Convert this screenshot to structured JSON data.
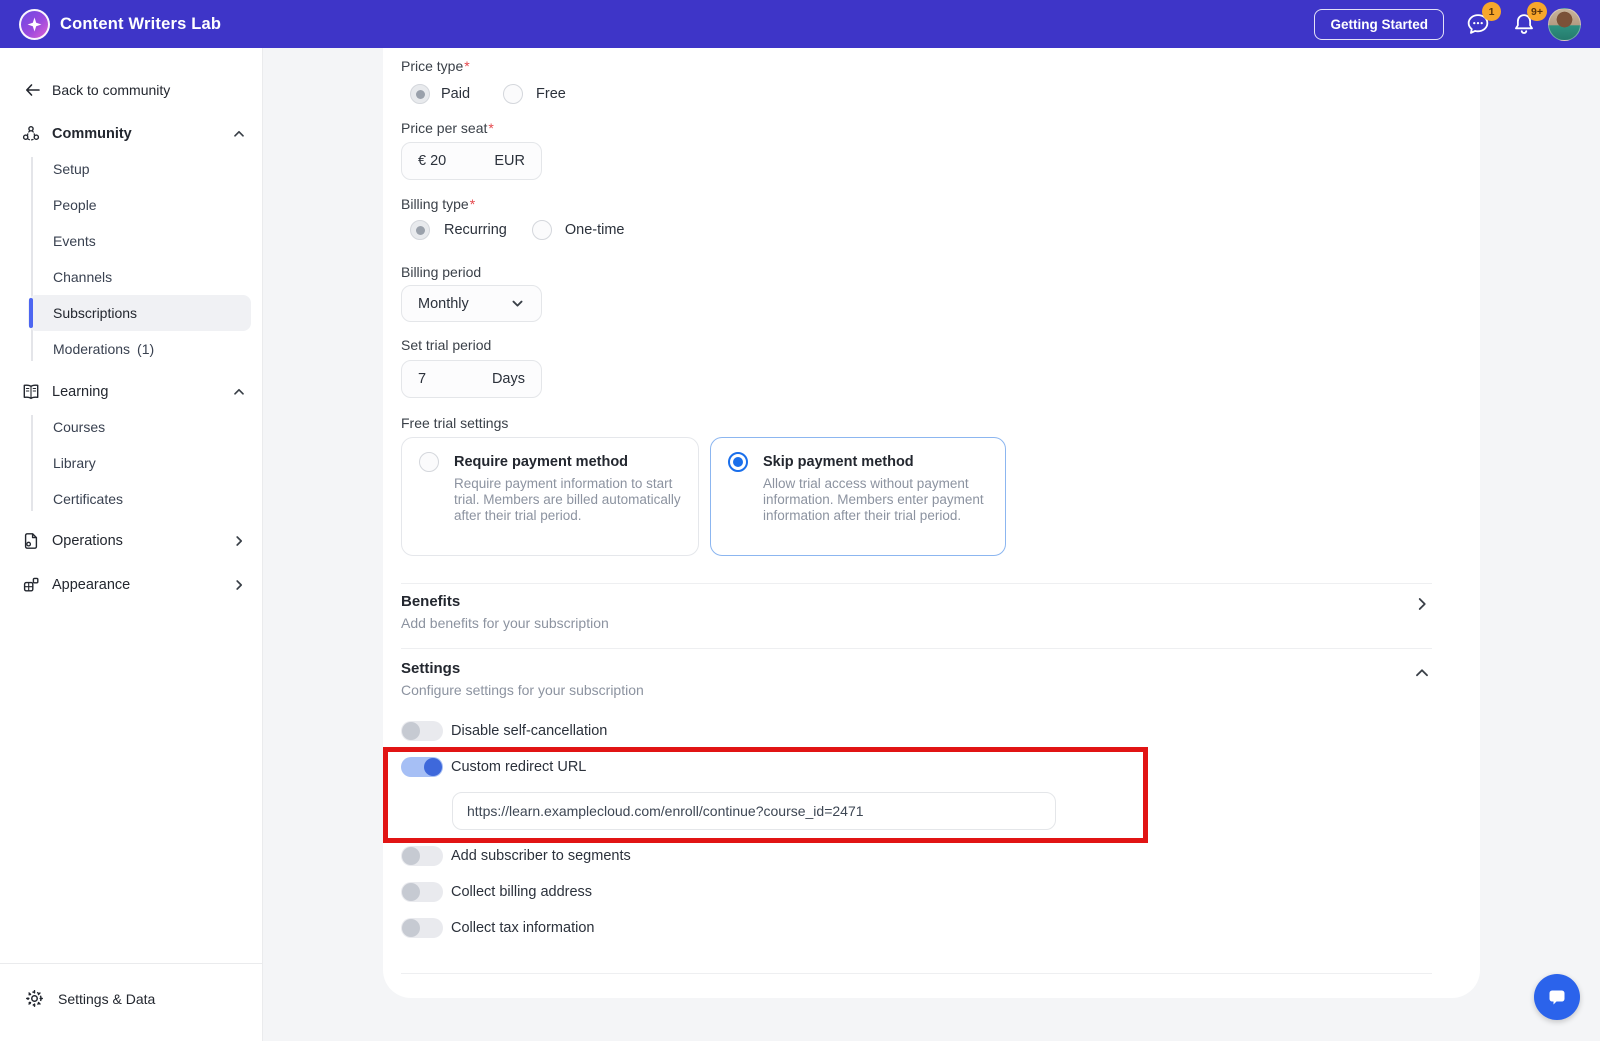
{
  "header": {
    "app_name": "Content Writers Lab",
    "getting_started": "Getting Started",
    "chat_badge": "1",
    "bell_badge": "9+"
  },
  "sidebar": {
    "back": "Back to community",
    "community": {
      "label": "Community",
      "items": {
        "setup": "Setup",
        "people": "People",
        "events": "Events",
        "channels": "Channels",
        "subscriptions": "Subscriptions",
        "moderations": "Moderations",
        "moderations_count": "(1)"
      }
    },
    "learning": {
      "label": "Learning",
      "items": {
        "courses": "Courses",
        "library": "Library",
        "certificates": "Certificates"
      }
    },
    "operations": "Operations",
    "appearance": "Appearance",
    "settings_data": "Settings & Data"
  },
  "form": {
    "required_mark": "*",
    "price_type": {
      "label": "Price type",
      "paid": "Paid",
      "free": "Free",
      "selected": "Paid"
    },
    "price_per_seat": {
      "label": "Price per seat",
      "value": "€ 20",
      "suffix": "EUR"
    },
    "billing_type": {
      "label": "Billing type",
      "recurring": "Recurring",
      "one_time": "One-time",
      "selected": "Recurring"
    },
    "billing_period": {
      "label": "Billing period",
      "value": "Monthly"
    },
    "trial_period": {
      "label": "Set trial period",
      "value": "7",
      "suffix": "Days"
    },
    "free_trial": {
      "label": "Free trial settings",
      "require": {
        "title": "Require payment method",
        "desc": "Require payment information to start trial. Members are billed automatically after their trial period.",
        "selected": false
      },
      "skip": {
        "title": "Skip payment method",
        "desc": "Allow trial access without payment information. Members enter payment information after their trial period.",
        "selected": true
      }
    },
    "benefits": {
      "title": "Benefits",
      "subtitle": "Add benefits for your subscription"
    },
    "settings_section": {
      "title": "Settings",
      "subtitle": "Configure settings for your subscription"
    },
    "toggles": {
      "disable_self_cancellation": {
        "label": "Disable self-cancellation",
        "on": false
      },
      "custom_redirect": {
        "label": "Custom redirect URL",
        "on": true,
        "url": "https://learn.examplecloud.com/enroll/continue?course_id=2471"
      },
      "segments": {
        "label": "Add subscriber to segments",
        "on": false
      },
      "billing_address": {
        "label": "Collect billing address",
        "on": false
      },
      "tax": {
        "label": "Collect tax information",
        "on": false
      }
    }
  },
  "colors": {
    "header_bg": "#3E35C8",
    "accent_blue": "#1A6FEB",
    "toggle_on_knob": "#3E68DB",
    "badge_bg": "#F7A72B",
    "annotation_red": "#E11414",
    "fab_blue": "#2B63EB",
    "active_item_bar": "#4D66F1"
  }
}
